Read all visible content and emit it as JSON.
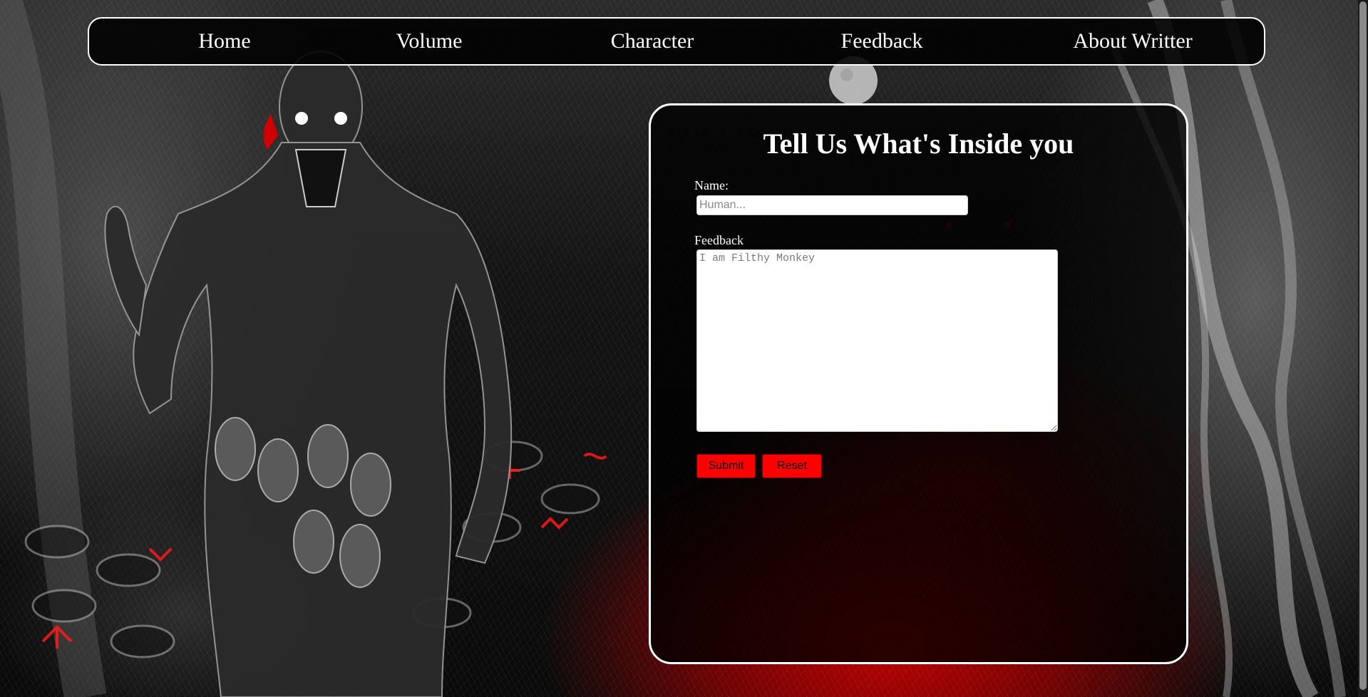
{
  "nav": {
    "items": [
      {
        "label": "Home"
      },
      {
        "label": "Volume"
      },
      {
        "label": "Character"
      },
      {
        "label": "Feedback"
      },
      {
        "label": "About Writter"
      }
    ]
  },
  "form": {
    "title": "Tell Us What's Inside you",
    "name_label": "Name:",
    "name_value": "",
    "name_placeholder": "Human...",
    "feedback_label": "Feedback",
    "feedback_value": "",
    "feedback_placeholder": "I am Filthy Monkey",
    "submit_label": "Submit",
    "reset_label": "Reset"
  },
  "colors": {
    "accent": "#ff0000",
    "border": "#ffffff",
    "panel_background": "#000000"
  }
}
